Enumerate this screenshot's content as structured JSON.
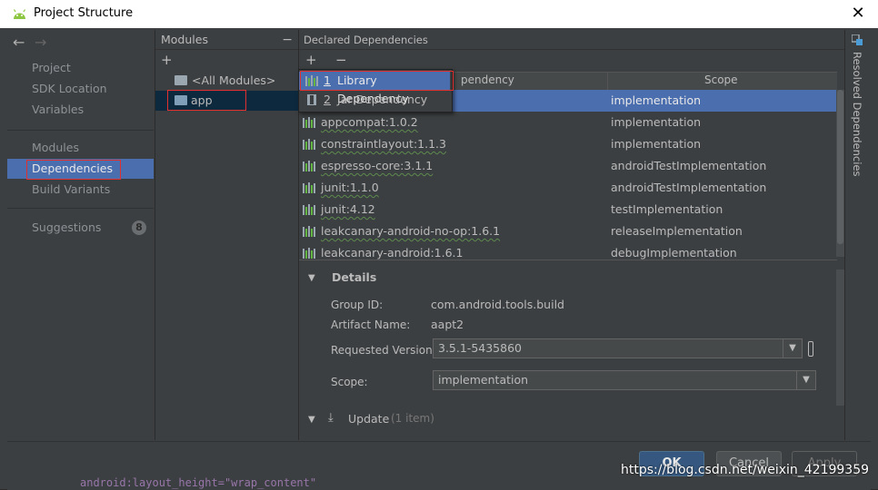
{
  "title": "Project Structure",
  "sidebar": {
    "items": [
      {
        "label": "Project"
      },
      {
        "label": "SDK Location"
      },
      {
        "label": "Variables"
      },
      {
        "label": "Modules"
      },
      {
        "label": "Dependencies"
      },
      {
        "label": "Build Variants"
      },
      {
        "label": "Suggestions",
        "badge": "8"
      }
    ]
  },
  "modules": {
    "header": "Modules",
    "add": "+",
    "remove": "−",
    "items": [
      {
        "label": "<All Modules>"
      },
      {
        "label": "app"
      }
    ]
  },
  "dependencies": {
    "header": "Declared Dependencies",
    "add": "+",
    "remove": "−",
    "columns": {
      "name": "pendency",
      "scope": "Scope"
    },
    "rows": [
      {
        "name": "",
        "scope": "implementation"
      },
      {
        "name": "appcompat:1.0.2",
        "scope": "implementation"
      },
      {
        "name": "constraintlayout:1.1.3",
        "scope": "implementation"
      },
      {
        "name": "espresso-core:3.1.1",
        "scope": "androidTestImplementation"
      },
      {
        "name": "junit:1.1.0",
        "scope": "androidTestImplementation"
      },
      {
        "name": "junit:4.12",
        "scope": "testImplementation"
      },
      {
        "name": "leakcanary-android-no-op:1.6.1",
        "scope": "releaseImplementation"
      },
      {
        "name": "leakcanary-android:1.6.1",
        "scope": "debugImplementation"
      }
    ]
  },
  "popup": {
    "items": [
      {
        "mnemonic": "1",
        "label": "Library Dependency"
      },
      {
        "mnemonic": "2",
        "label": "Jar Dependency"
      }
    ]
  },
  "details": {
    "heading": "Details",
    "group_label": "Group ID:",
    "group_value": "com.android.tools.build",
    "artifact_label": "Artifact Name:",
    "artifact_value": "aapt2",
    "version_label": "Requested Version:",
    "version_value": "3.5.1-5435860",
    "scope_label": "Scope:",
    "scope_value": "implementation",
    "update_label": "Update",
    "update_count": "(1 item)"
  },
  "resolved_label": "Resolved Dependencies",
  "buttons": {
    "ok": "OK",
    "cancel": "Cancel",
    "apply": "Apply"
  },
  "code_line": "android:layout_height=\"wrap_content\"",
  "watermark": "https://blog.csdn.net/weixin_42199359",
  "colors": {
    "selection": "#4b6eaf",
    "accent_ok": "#365880",
    "highlight_box": "#e03030"
  }
}
